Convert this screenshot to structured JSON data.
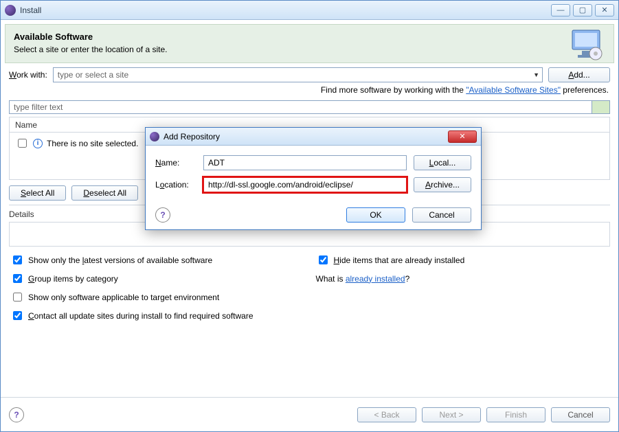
{
  "window": {
    "title": "Install"
  },
  "banner": {
    "heading": "Available Software",
    "sub": "Select a site or enter the location of a site."
  },
  "workwith": {
    "label": "Work with:",
    "placeholder": "type or select a site",
    "add_btn": "Add..."
  },
  "hint": {
    "prefix": "Find more software by working with the ",
    "link": "\"Available Software Sites\"",
    "suffix": " preferences."
  },
  "filter": {
    "placeholder": "type filter text"
  },
  "table": {
    "header": "Name",
    "empty_msg": "There is no site selected."
  },
  "sel": {
    "select_all": "Select All",
    "deselect_all": "Deselect All"
  },
  "details": {
    "label": "Details"
  },
  "opts": {
    "latest": "Show only the latest versions of available software",
    "hide_installed": "Hide items that are already installed",
    "group": "Group items by category",
    "what_is_prefix": "What is ",
    "what_is_link": "already installed",
    "applicable": "Show only software applicable to target environment",
    "contact": "Contact all update sites during install to find required software"
  },
  "wizard": {
    "back": "< Back",
    "next": "Next >",
    "finish": "Finish",
    "cancel": "Cancel"
  },
  "dialog": {
    "title": "Add Repository",
    "name_label": "Name:",
    "name_value": "ADT",
    "loc_label": "Location:",
    "loc_value": "http://dl-ssl.google.com/android/eclipse/",
    "local_btn": "Local...",
    "archive_btn": "Archive...",
    "ok": "OK",
    "cancel": "Cancel"
  }
}
